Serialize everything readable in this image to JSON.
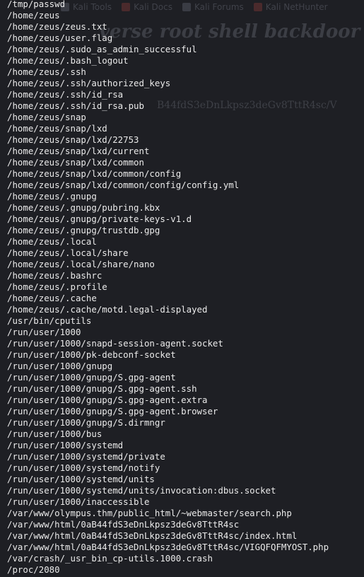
{
  "background_page": {
    "bookmarks": [
      {
        "label": "Kali Tools",
        "icon": "kali-icon"
      },
      {
        "label": "Kali Docs",
        "icon": "kali-docs-icon"
      },
      {
        "label": "Kali Forums",
        "icon": "kali-forums-icon"
      },
      {
        "label": "Kali NetHunter",
        "icon": "nethunter-icon"
      }
    ],
    "heading": "verse root shell backdoor",
    "fragment": "B44fdS3eDnLkpsz3deGv8TttR4sc/V"
  },
  "terminal": {
    "lines": [
      "/tmp/passwd",
      "/home/zeus",
      "/home/zeus/zeus.txt",
      "/home/zeus/user.flag",
      "/home/zeus/.sudo_as_admin_successful",
      "/home/zeus/.bash_logout",
      "/home/zeus/.ssh",
      "/home/zeus/.ssh/authorized_keys",
      "/home/zeus/.ssh/id_rsa",
      "/home/zeus/.ssh/id_rsa.pub",
      "/home/zeus/snap",
      "/home/zeus/snap/lxd",
      "/home/zeus/snap/lxd/22753",
      "/home/zeus/snap/lxd/current",
      "/home/zeus/snap/lxd/common",
      "/home/zeus/snap/lxd/common/config",
      "/home/zeus/snap/lxd/common/config/config.yml",
      "/home/zeus/.gnupg",
      "/home/zeus/.gnupg/pubring.kbx",
      "/home/zeus/.gnupg/private-keys-v1.d",
      "/home/zeus/.gnupg/trustdb.gpg",
      "/home/zeus/.local",
      "/home/zeus/.local/share",
      "/home/zeus/.local/share/nano",
      "/home/zeus/.bashrc",
      "/home/zeus/.profile",
      "/home/zeus/.cache",
      "/home/zeus/.cache/motd.legal-displayed",
      "/usr/bin/cputils",
      "/run/user/1000",
      "/run/user/1000/snapd-session-agent.socket",
      "/run/user/1000/pk-debconf-socket",
      "/run/user/1000/gnupg",
      "/run/user/1000/gnupg/S.gpg-agent",
      "/run/user/1000/gnupg/S.gpg-agent.ssh",
      "/run/user/1000/gnupg/S.gpg-agent.extra",
      "/run/user/1000/gnupg/S.gpg-agent.browser",
      "/run/user/1000/gnupg/S.dirmngr",
      "/run/user/1000/bus",
      "/run/user/1000/systemd",
      "/run/user/1000/systemd/private",
      "/run/user/1000/systemd/notify",
      "/run/user/1000/systemd/units",
      "/run/user/1000/systemd/units/invocation:dbus.socket",
      "/run/user/1000/inaccessible",
      "/var/www/olympus.thm/public_html/~webmaster/search.php",
      "/var/www/html/0aB44fdS3eDnLkpsz3deGv8TttR4sc",
      "/var/www/html/0aB44fdS3eDnLkpsz3deGv8TttR4sc/index.html",
      "/var/www/html/0aB44fdS3eDnLkpsz3deGv8TttR4sc/VIGQFQFMYOST.php",
      "/var/crash/_usr_bin_cp-utils.1000.crash",
      "/proc/2080"
    ]
  }
}
